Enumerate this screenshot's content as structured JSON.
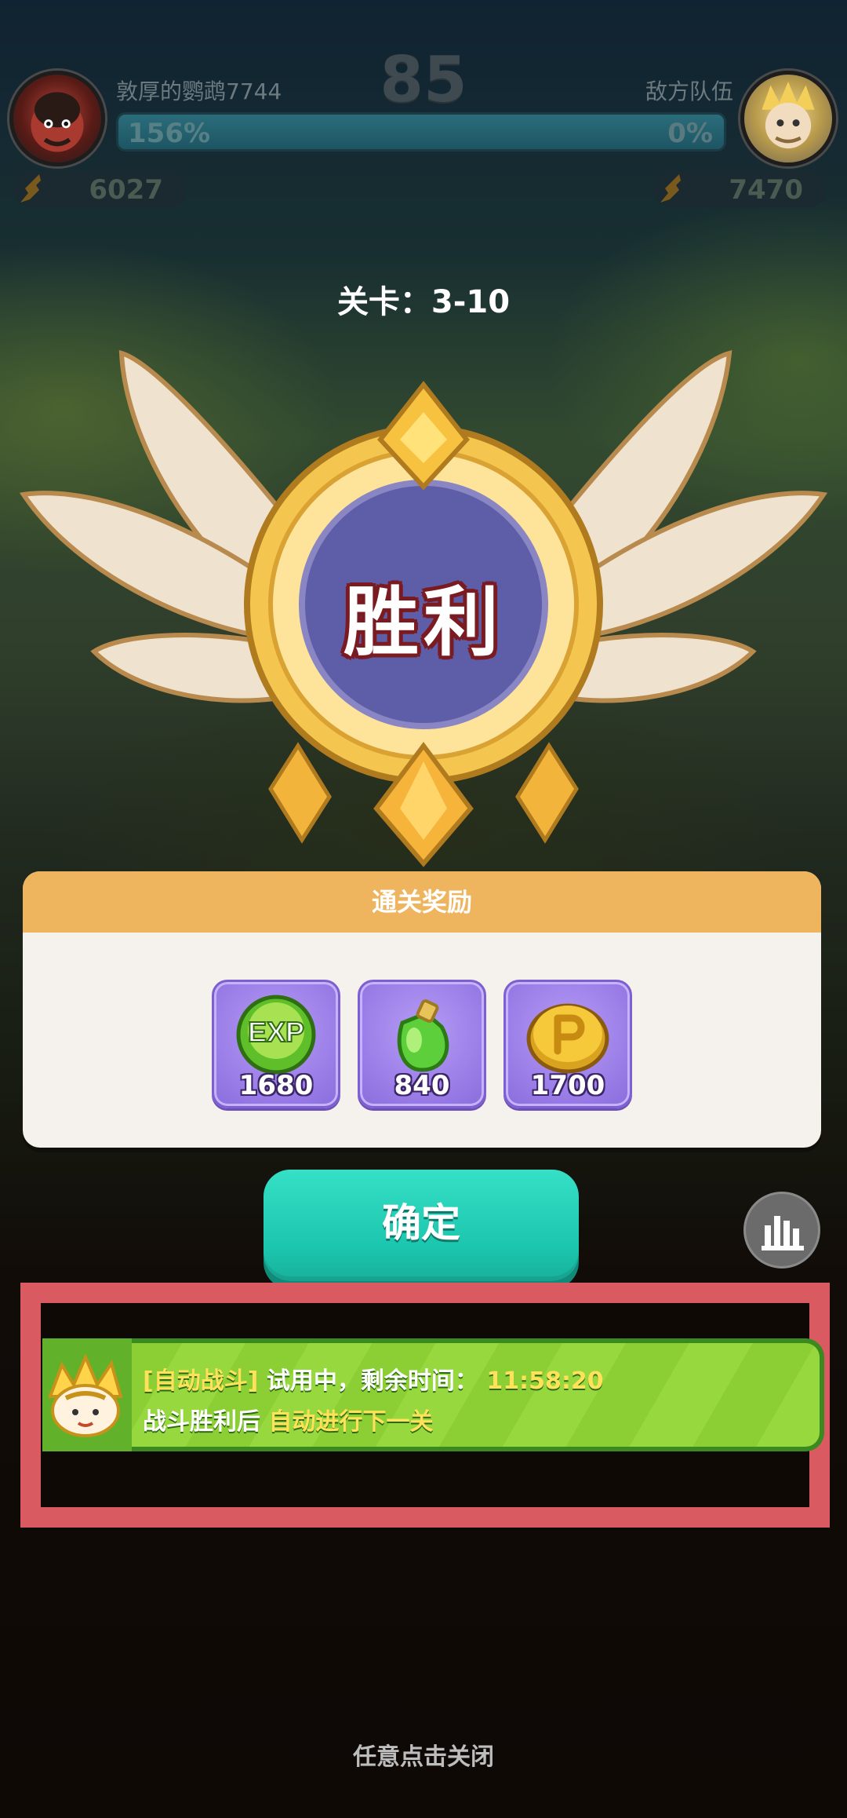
{
  "hud": {
    "timer": "85",
    "player": {
      "name": "敦厚的鹦鹉7744",
      "percent": "156%",
      "power": "6027"
    },
    "enemy": {
      "name": "敌方队伍",
      "percent": "0%",
      "power": "7470"
    },
    "player_progress": 1.0
  },
  "stage": {
    "label": "关卡：3-10"
  },
  "result": {
    "title": "胜利"
  },
  "rewards": {
    "header": "通关奖励",
    "items": [
      {
        "icon": "exp-orb-icon",
        "icon_text": "EXP",
        "count": "1680"
      },
      {
        "icon": "green-potion-icon",
        "count": "840"
      },
      {
        "icon": "gold-coin-icon",
        "count": "1700"
      }
    ]
  },
  "buttons": {
    "confirm": "确定",
    "stats_icon": "bar-chart-icon"
  },
  "auto_battle": {
    "tag": "[自动战斗]",
    "trial": "试用中，剩余时间：",
    "time": "11:58:20",
    "line2_prefix": "战斗胜利后",
    "line2_highlight": "自动进行下一关"
  },
  "close_hint": "任意点击关闭",
  "colors": {
    "reward_header": "#eeb45e",
    "confirm_button": "#1cc6ae",
    "auto_banner": "#96d83d",
    "highlight_border": "#d95a61",
    "victory_outline": "#7a1b22"
  }
}
